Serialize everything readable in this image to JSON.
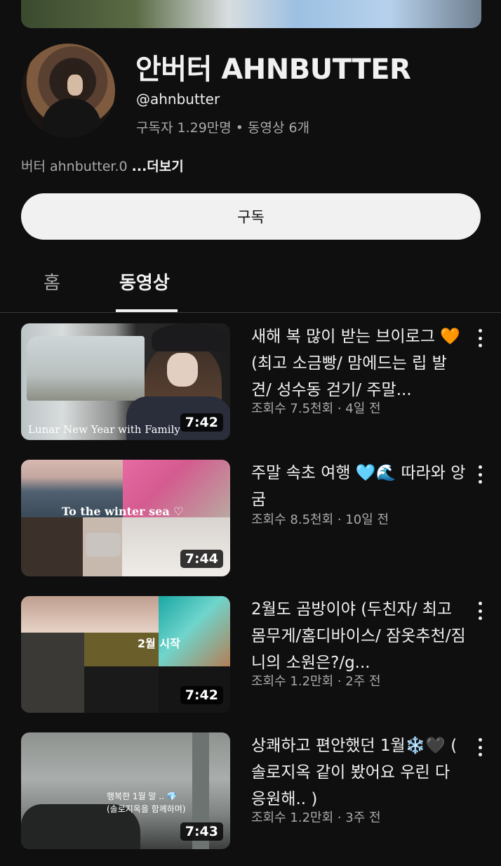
{
  "channel": {
    "name": "안버터 AHNBUTTER",
    "handle": "@ahnbutter",
    "stats": "구독자 1.29만명 • 동영상 6개",
    "description": "버터 ahnbutter.0 ",
    "more_label": "...더보기",
    "subscribe_label": "구독"
  },
  "tabs": [
    {
      "label": "홈",
      "active": false
    },
    {
      "label": "동영상",
      "active": true
    }
  ],
  "videos": [
    {
      "title": "새해 복 많이 받는 브이로그 🧡 (최고 소금빵/ 맘에드는 립 발견/ 성수동 걷기/ 주말...",
      "meta": "조회수 7.5천회 · 4일 전",
      "duration": "7:42",
      "thumb_caption": "Lunar New Year with Family"
    },
    {
      "title": "주말 속초 여행 🩵🌊 따라와 앙굼",
      "meta": "조회수 8.5천회 · 10일 전",
      "duration": "7:44",
      "thumb_caption": "To the winter sea ♡"
    },
    {
      "title": "2월도 곰방이야 (두친자/ 최고몸무게/홈디바이스/ 잠옷추천/짐니의 소원은?/g...",
      "meta": "조회수 1.2만회 · 2주 전",
      "duration": "7:42",
      "thumb_caption": "2월 시작"
    },
    {
      "title": "상쾌하고 편안했던 1월❄️🖤 ( 솔로지옥 같이 봤어요 우린 다 응원해.. )",
      "meta": "조회수 1.2만회 · 3주 전",
      "duration": "7:43",
      "thumb_caption": "행복한 1월 말 .. 💎",
      "thumb_caption_2": "(솔로지옥을 함께하며)"
    }
  ],
  "icons": {
    "kebab": "more-vert-icon"
  },
  "colors": {
    "background": "#0f0f0f",
    "text_primary": "#f1f1f1",
    "text_secondary": "#aaaaaa",
    "subscribe_bg": "#f1f1f1"
  }
}
